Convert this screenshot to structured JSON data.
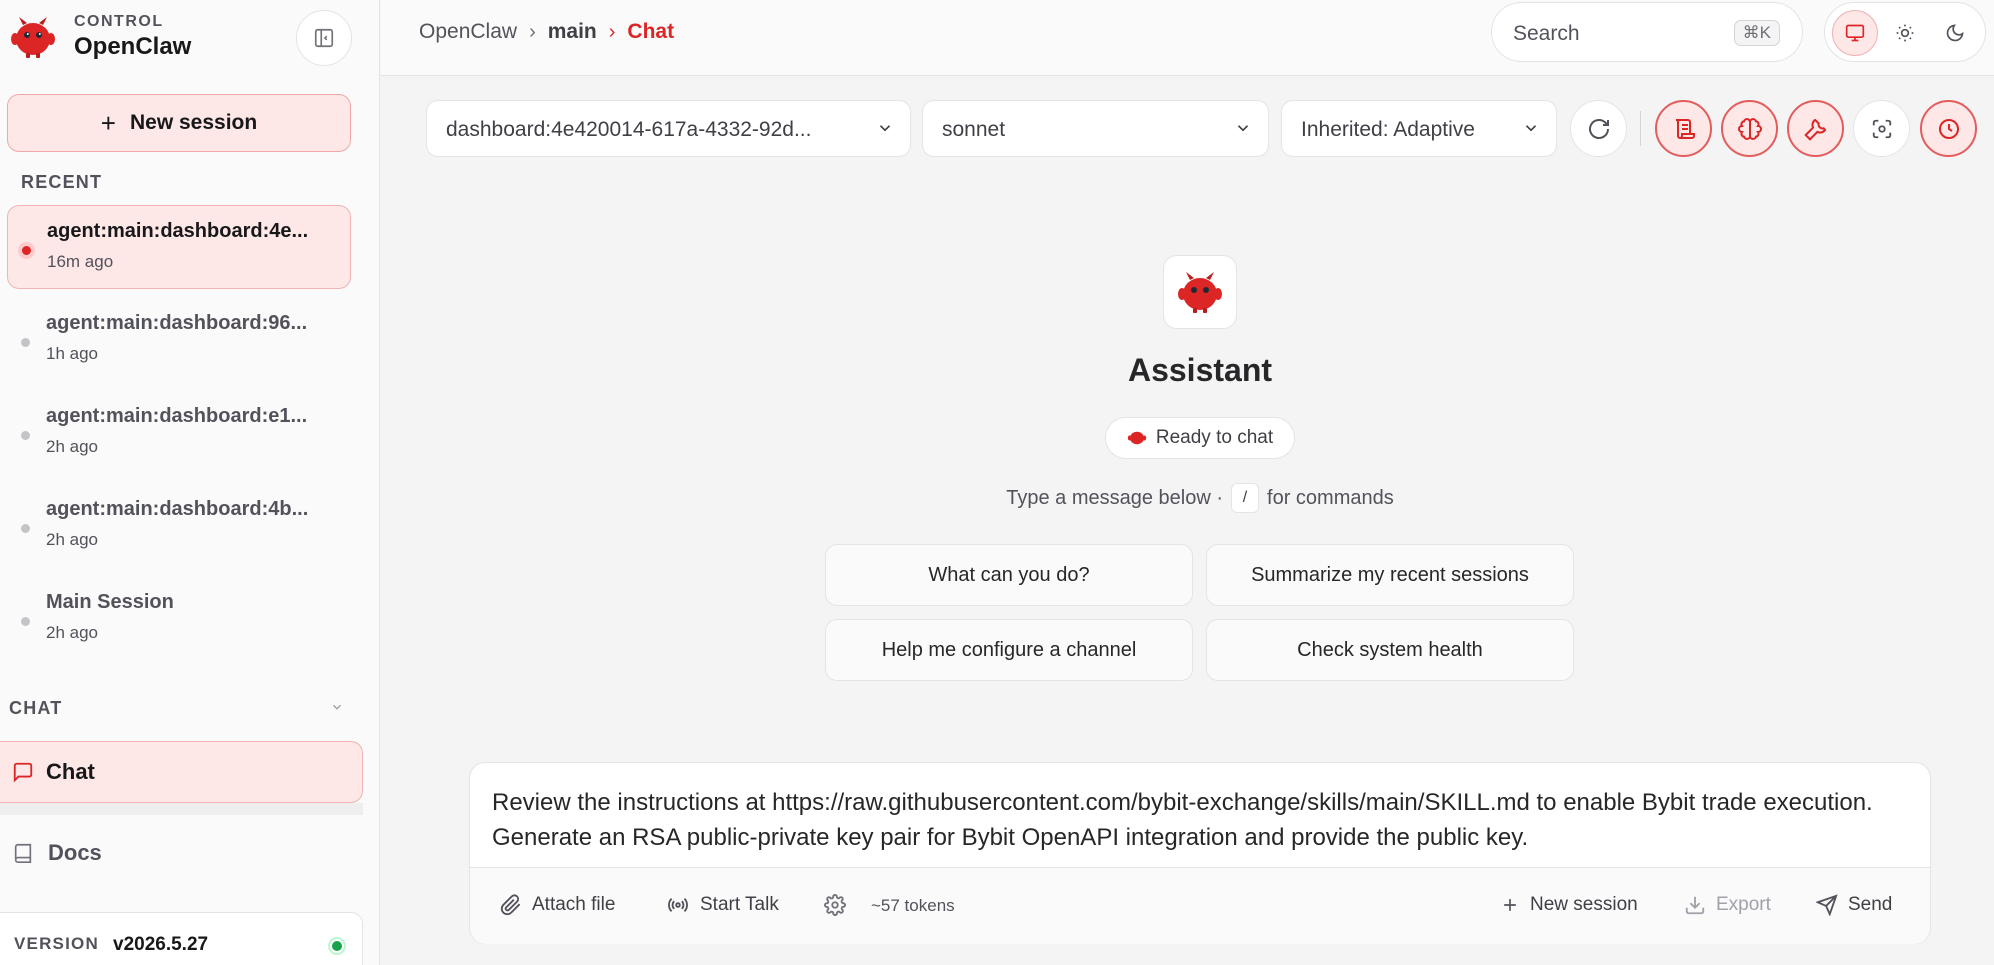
{
  "brand": {
    "eyebrow": "CONTROL",
    "name": "OpenClaw"
  },
  "sidebar": {
    "new_session_label": "New session",
    "recent_label": "RECENT",
    "sessions": [
      {
        "title": "agent:main:dashboard:4e...",
        "time": "16m ago",
        "active": true
      },
      {
        "title": "agent:main:dashboard:96...",
        "time": "1h ago",
        "active": false
      },
      {
        "title": "agent:main:dashboard:e1...",
        "time": "2h ago",
        "active": false
      },
      {
        "title": "agent:main:dashboard:4b...",
        "time": "2h ago",
        "active": false
      },
      {
        "title": "Main Session",
        "time": "2h ago",
        "active": false
      }
    ],
    "chat_section_label": "CHAT",
    "nav": [
      {
        "label": "Chat",
        "icon": "message-square-icon",
        "active": true
      },
      {
        "label": "Docs",
        "icon": "book-icon",
        "active": false
      }
    ],
    "version_label": "VERSION",
    "version_value": "v2026.5.27",
    "status_color": "#16a34a"
  },
  "header": {
    "breadcrumb": [
      "OpenClaw",
      "main",
      "Chat"
    ],
    "search_placeholder": "Search",
    "search_shortcut": "⌘K",
    "theme_modes": [
      "system",
      "light",
      "dark"
    ],
    "active_theme": "system"
  },
  "controls": {
    "session_select": "dashboard:4e420014-617a-4332-92d...",
    "model_select": "sonnet",
    "thinking_select": "Inherited: Adaptive",
    "actions": [
      "refresh-icon",
      "scroll-icon",
      "brain-icon",
      "wrench-icon",
      "focus-icon",
      "clock-icon"
    ]
  },
  "assistant": {
    "name": "Assistant",
    "status": "Ready to chat",
    "hint_before": "Type a message below ·",
    "hint_key": "/",
    "hint_after": "for commands",
    "suggestions": [
      "What can you do?",
      "Summarize my recent sessions",
      "Help me configure a channel",
      "Check system health"
    ]
  },
  "composer": {
    "text": "Review the instructions at https://raw.githubusercontent.com/bybit-exchange/skills/main/SKILL.md to enable Bybit trade execution. Generate an RSA public-private key pair for Bybit OpenAPI integration and provide the public key.",
    "attach_label": "Attach file",
    "talk_label": "Start Talk",
    "tokens": "~57 tokens",
    "new_session_label": "New session",
    "export_label": "Export",
    "send_label": "Send"
  },
  "colors": {
    "accent": "#dc2626",
    "accent_soft": "#fde7e7"
  }
}
